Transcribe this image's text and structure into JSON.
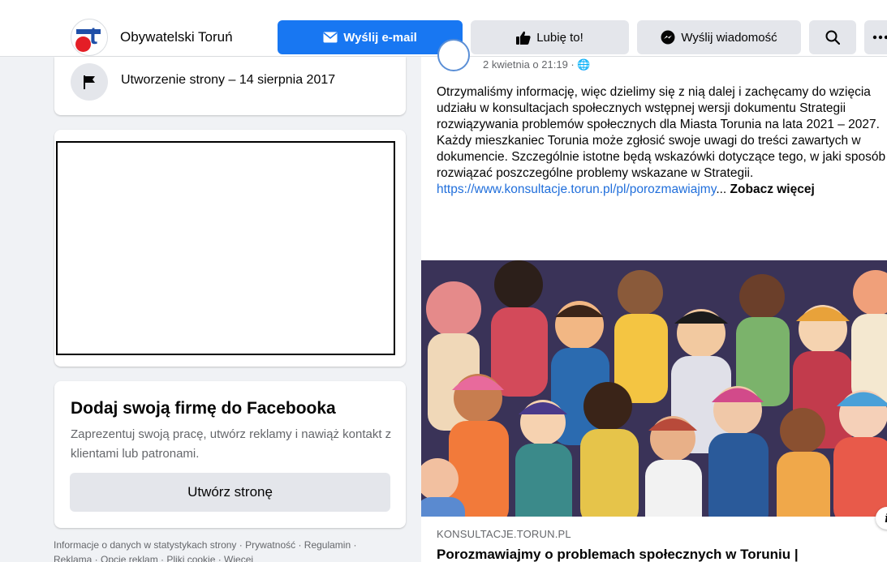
{
  "header": {
    "page_name": "Obywatelski Toruń",
    "email_button": "Wyślij e-mail",
    "like_button": "Lubię to!",
    "message_button": "Wyślij wiadomość",
    "search_icon": "search-icon",
    "more_icon": "more-icon"
  },
  "colors": {
    "accent": "#1877f2",
    "button_gray": "#e4e6eb",
    "background": "#f0f2f5",
    "link": "#216fdb",
    "secondary_text": "#65676b"
  },
  "left": {
    "created_text": "Utworzenie strony – 14 sierpnia 2017",
    "business": {
      "title": "Dodaj swoją firmę do Facebooka",
      "description": "Zaprezentuj swoją pracę, utwórz reklamy i nawiąż kontakt z klientami lub patronami.",
      "button": "Utwórz stronę"
    },
    "footer": "Informacje o danych w statystykach strony · Prywatność · Regulamin · Reklama · Opcje reklam · Pliki cookie · Więcej"
  },
  "post": {
    "meta": "2 kwietnia o 21:19 · 🌐",
    "paragraph1": "Otrzymaliśmy informację, więc dzielimy się z nią dalej i zachęcamy do wzięcia udziału w konsultacjach społecznych  wstępnej wersji dokumentu Strategii rozwiązywania problemów społecznych dla Miasta Torunia na lata 2021 – 2027.",
    "paragraph2": "Każdy mieszkaniec Torunia może zgłosić swoje uwagi do treści zawartych w dokumencie. Szczególnie istotne będą wskazówki dotyczące tego, w jaki sposób rozwiązać poszczególne problemy wskazane w Strategii.",
    "link": "https://www.konsultacje.torun.pl/pl/porozmawiajmy",
    "ellipsis": "...",
    "see_more": "Zobacz więcej",
    "link_domain": "KONSULTACJE.TORUN.PL",
    "link_title": "Porozmawiajmy o problemach społecznych w Toruniu |"
  }
}
